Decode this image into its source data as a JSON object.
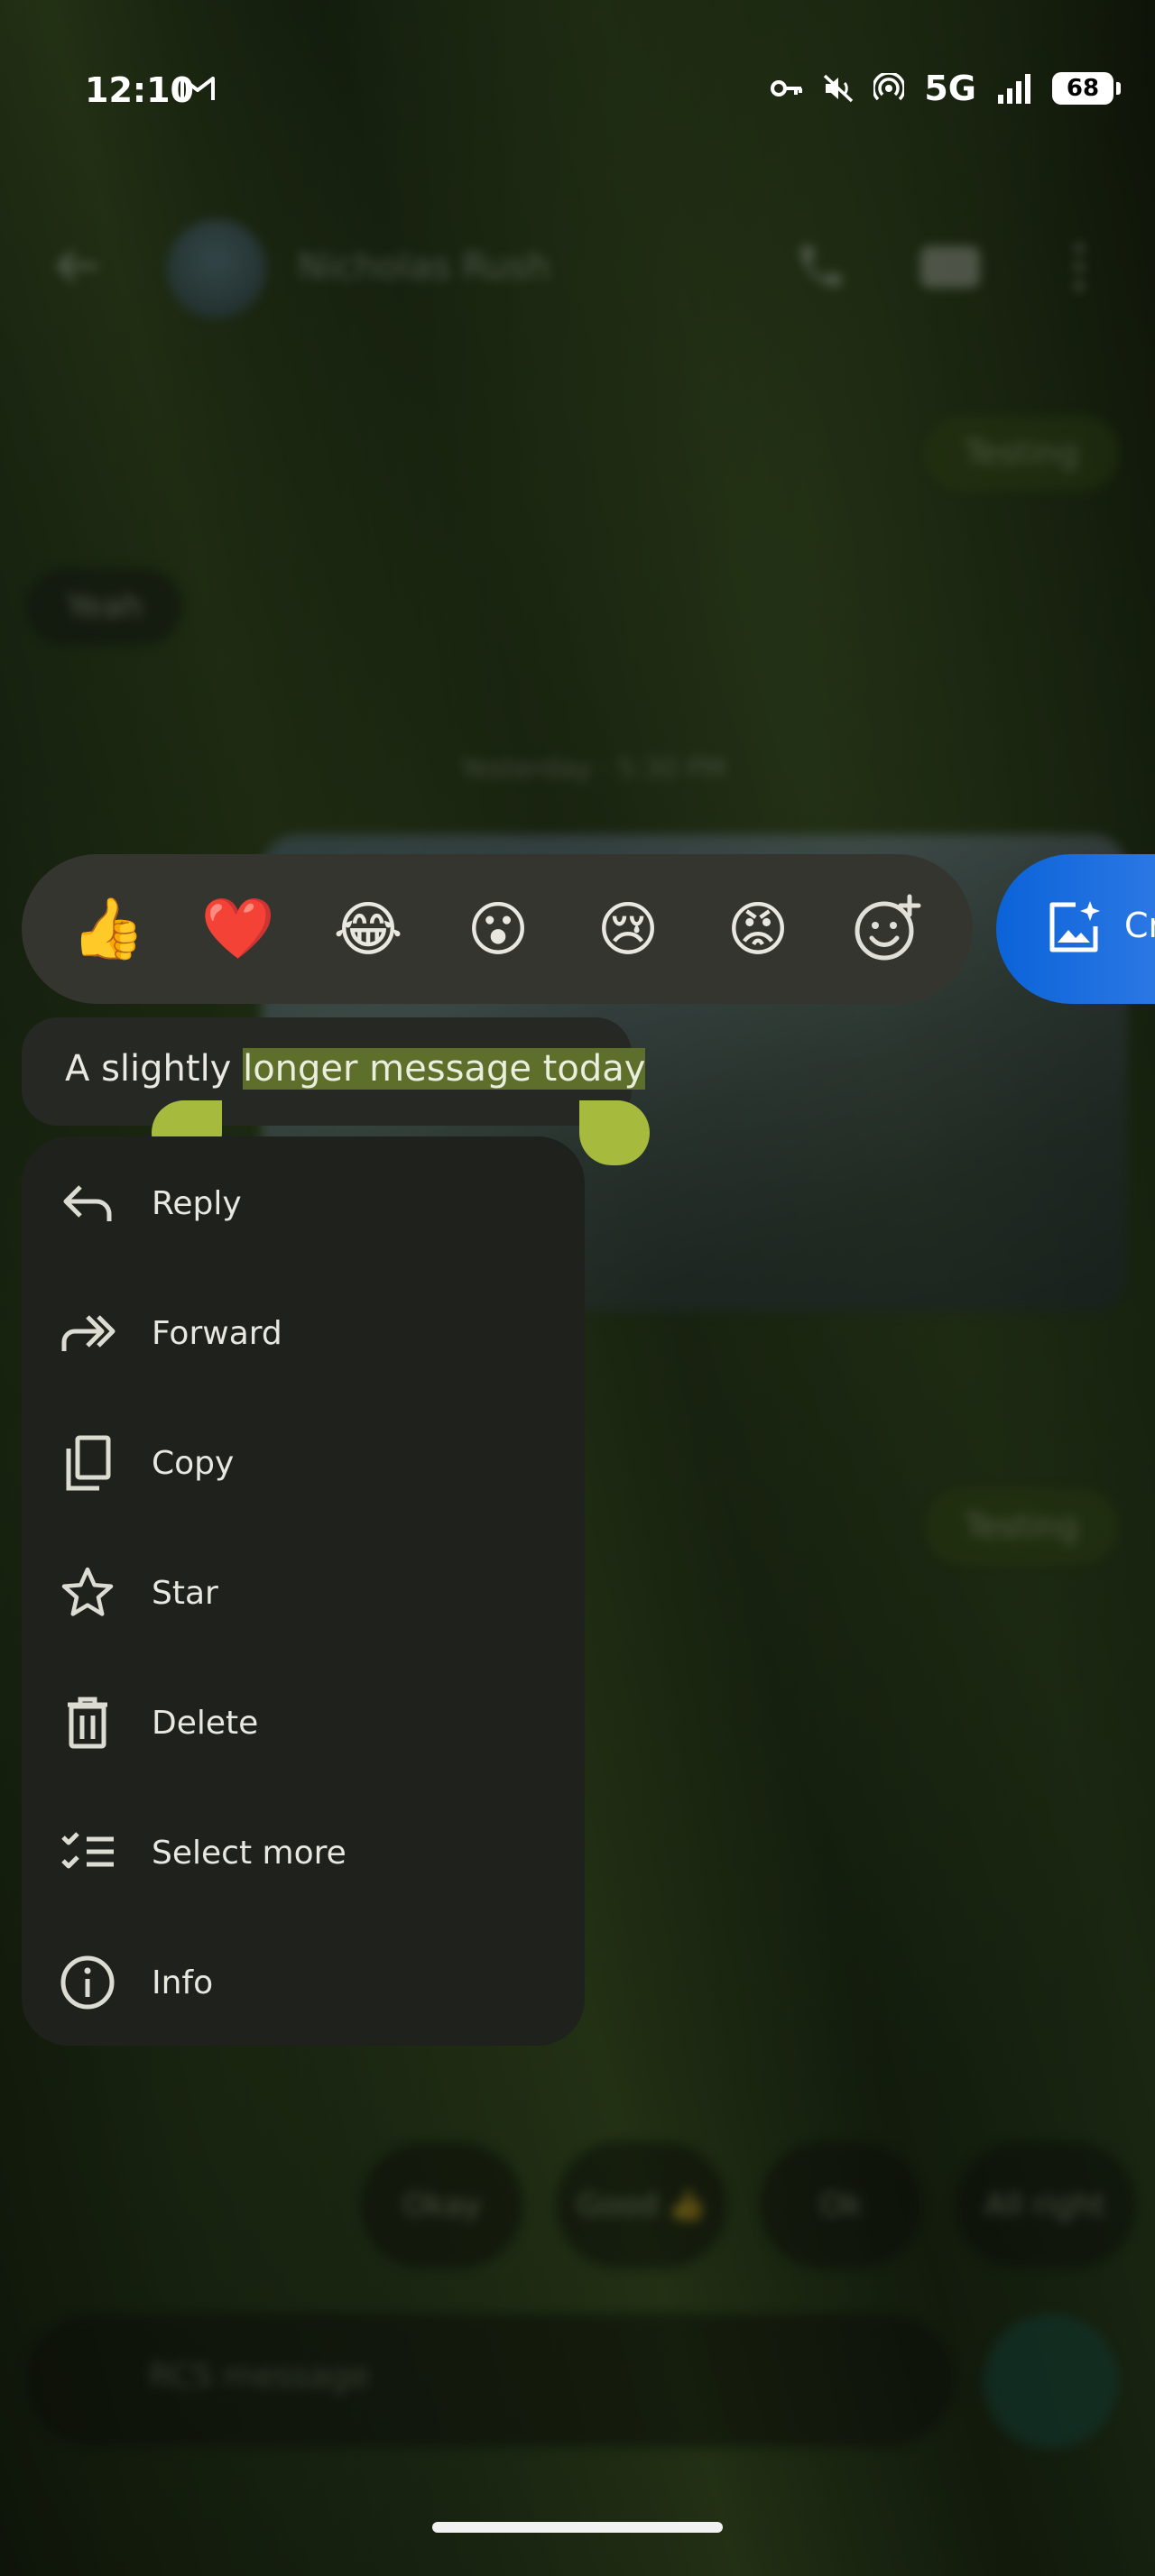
{
  "status_bar": {
    "time": "12:10",
    "network": "5G",
    "battery": "68"
  },
  "background_chat": {
    "contact_name": "Nicholas Rush",
    "bubbles_right": [
      "Testing",
      "Testing"
    ],
    "bubbles_left": [
      "Yeah"
    ],
    "timestamp": "Yesterday · 5:30 PM",
    "smart_replies": [
      "Okay",
      "Good 👍",
      "Ok",
      "All right"
    ],
    "compose_placeholder": "RCS message"
  },
  "reactions": [
    {
      "emoji": "👍",
      "name": "thumbs-up"
    },
    {
      "emoji": "❤️",
      "name": "heart"
    },
    {
      "emoji": "😂",
      "name": "tears-of-joy"
    },
    {
      "emoji": "😮",
      "name": "surprised"
    },
    {
      "emoji": "😢",
      "name": "crying"
    },
    {
      "emoji": "😡",
      "name": "angry"
    }
  ],
  "create_button": {
    "label": "Cr"
  },
  "selected_message": {
    "prefix": "A slightly ",
    "selected": "longer message today"
  },
  "menu": [
    {
      "label": "Reply",
      "icon": "reply-icon"
    },
    {
      "label": "Forward",
      "icon": "forward-icon"
    },
    {
      "label": "Copy",
      "icon": "copy-icon"
    },
    {
      "label": "Star",
      "icon": "star-icon"
    },
    {
      "label": "Delete",
      "icon": "trash-icon"
    },
    {
      "label": "Select more",
      "icon": "checklist-icon"
    },
    {
      "label": "Info",
      "icon": "info-icon"
    }
  ],
  "colors": {
    "selection_highlight": "#5e6f2c",
    "handle": "#a6bb3e",
    "create_button": "#0b63d8",
    "menu_bg": "#1f211d"
  }
}
